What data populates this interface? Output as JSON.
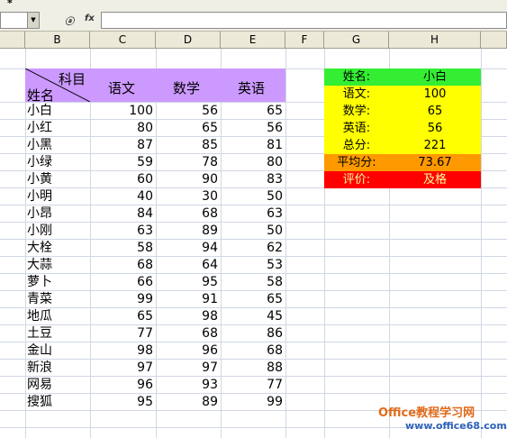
{
  "window": {
    "title_mark": "*"
  },
  "formula_bar": {
    "namebox_value": "",
    "icon_a": "ⓐ",
    "fx_label": "fx",
    "formula": ""
  },
  "columns": [
    "B",
    "C",
    "D",
    "E",
    "F",
    "G",
    "H"
  ],
  "table": {
    "header": {
      "top_right": "科目",
      "bottom_left": "姓名",
      "chinese": "语文",
      "math": "数学",
      "english": "英语"
    },
    "rows": [
      {
        "name": "小白",
        "chinese": "100",
        "math": "56",
        "english": "65"
      },
      {
        "name": "小红",
        "chinese": "80",
        "math": "65",
        "english": "56"
      },
      {
        "name": "小黑",
        "chinese": "87",
        "math": "85",
        "english": "81"
      },
      {
        "name": "小绿",
        "chinese": "59",
        "math": "78",
        "english": "80"
      },
      {
        "name": "小黄",
        "chinese": "60",
        "math": "90",
        "english": "83"
      },
      {
        "name": "小明",
        "chinese": "40",
        "math": "30",
        "english": "50"
      },
      {
        "name": "小昂",
        "chinese": "84",
        "math": "68",
        "english": "63"
      },
      {
        "name": "小刚",
        "chinese": "63",
        "math": "89",
        "english": "50"
      },
      {
        "name": "大栓",
        "chinese": "58",
        "math": "94",
        "english": "62"
      },
      {
        "name": "大蒜",
        "chinese": "68",
        "math": "64",
        "english": "53"
      },
      {
        "name": "萝卜",
        "chinese": "66",
        "math": "95",
        "english": "58"
      },
      {
        "name": "青菜",
        "chinese": "99",
        "math": "91",
        "english": "65"
      },
      {
        "name": "地瓜",
        "chinese": "65",
        "math": "98",
        "english": "45"
      },
      {
        "name": "土豆",
        "chinese": "77",
        "math": "68",
        "english": "86"
      },
      {
        "name": "金山",
        "chinese": "98",
        "math": "96",
        "english": "68"
      },
      {
        "name": "新浪",
        "chinese": "97",
        "math": "97",
        "english": "88"
      },
      {
        "name": "网易",
        "chinese": "96",
        "math": "93",
        "english": "77"
      },
      {
        "name": "搜狐",
        "chinese": "95",
        "math": "89",
        "english": "99"
      }
    ]
  },
  "panel": {
    "rows": [
      {
        "label": "姓名:",
        "value": "小白",
        "bg": "#33ee33",
        "fg": "#000000"
      },
      {
        "label": "语文:",
        "value": "100",
        "bg": "#ffff00",
        "fg": "#000000"
      },
      {
        "label": "数学:",
        "value": "65",
        "bg": "#ffff00",
        "fg": "#000000"
      },
      {
        "label": "英语:",
        "value": "56",
        "bg": "#ffff00",
        "fg": "#000000"
      },
      {
        "label": "总分:",
        "value": "221",
        "bg": "#ffff00",
        "fg": "#000000"
      },
      {
        "label": "平均分:",
        "value": "73.67",
        "bg": "#ff9900",
        "fg": "#000000"
      },
      {
        "label": "评价:",
        "value": "及格",
        "bg": "#ff0000",
        "fg": "#ffff99"
      }
    ]
  },
  "watermark": {
    "line1": "Office教程学习网",
    "line2": "www.office68.com"
  },
  "colors": {
    "header_purple": "#cc99ff",
    "grid": "#d0d7e5",
    "chrome": "#ece9d8"
  }
}
